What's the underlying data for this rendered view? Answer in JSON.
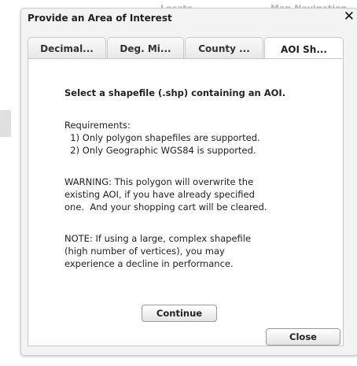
{
  "background": {
    "locate_label": "Locate",
    "nav_label": "Map Navigation"
  },
  "dialog": {
    "title": "Provide an Area of Interest",
    "close_symbol": "✕"
  },
  "tabs": [
    {
      "label": "Decimal...",
      "active": false
    },
    {
      "label": "Deg. Mi...",
      "active": false
    },
    {
      "label": "County ...",
      "active": false
    },
    {
      "label": "AOI Sh...",
      "active": true
    }
  ],
  "content": {
    "heading": "Select a shapefile (.shp) containing an AOI.",
    "requirements_title": "Requirements:",
    "requirement_1": "  1) Only polygon shapefiles are supported.",
    "requirement_2": "  2) Only Geographic WGS84 is supported.",
    "warning_line_1": "WARNING: This polygon will overwrite the",
    "warning_line_2": "existing AOI, if you have already specified",
    "warning_line_3": "one.  And your shopping cart will be cleared.",
    "note_line_1": "NOTE: If using a large, complex shapefile",
    "note_line_2": "(high number of vertices), you may",
    "note_line_3": "experience a decline in performance."
  },
  "buttons": {
    "continue_label": "Continue",
    "close_label": "Close"
  }
}
